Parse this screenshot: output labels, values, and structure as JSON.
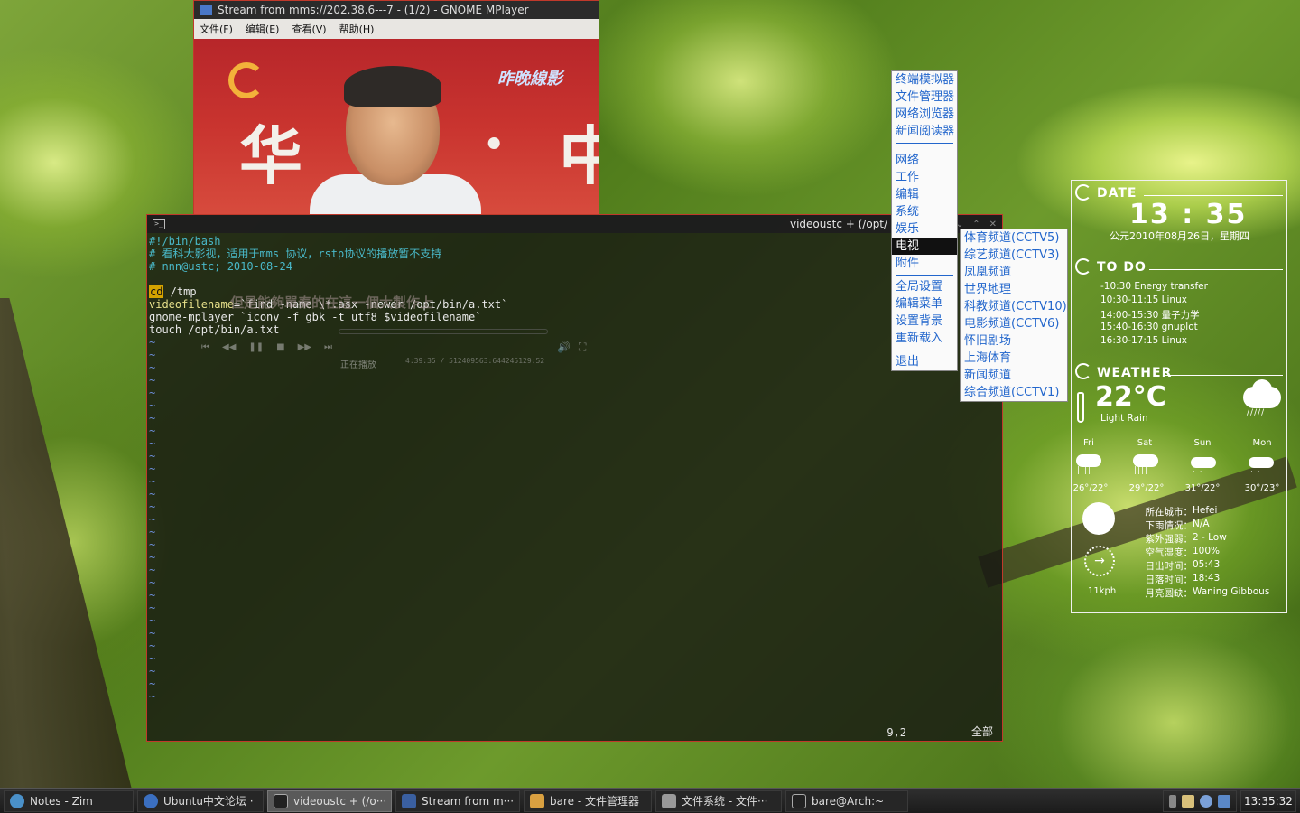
{
  "mplayer": {
    "title": "Stream from mms://202.38.6---7 - (1/2) - GNOME MPlayer",
    "menu": [
      "文件(F)",
      "编辑(E)",
      "查看(V)",
      "帮助(H)"
    ],
    "video_brand": "昨晚線影",
    "video_chars": [
      "华",
      "·",
      "中"
    ],
    "subtitle": "但是能夠單秦的在這一個大製作上",
    "status": "正在播放",
    "time": "4:39:35 / 512409563:644245129:52"
  },
  "terminal": {
    "title": "videoustc + (/opt/",
    "lines": [
      {
        "type": "comment",
        "text": "#!/bin/bash"
      },
      {
        "type": "comment",
        "text": "# 看科大影视，适用于mms 协议，rstp协议的播放暂不支持"
      },
      {
        "type": "comment",
        "text": "# nnn@ustc; 2010-08-24"
      },
      {
        "type": "blank",
        "text": ""
      },
      {
        "type": "cd",
        "tag": "cd",
        "text": " /tmp"
      },
      {
        "type": "assign",
        "var": "videofilename",
        "text": "=`find -name \\*.asx -newer /opt/bin/a.txt`"
      },
      {
        "type": "cmd",
        "text": "gnome-mplayer `iconv -f gbk -t utf8 $videofilename`"
      },
      {
        "type": "cmd",
        "text": "touch /opt/bin/a.txt"
      }
    ],
    "tilde": "~",
    "position": "9,2",
    "scroll": "全部"
  },
  "root_menu": {
    "group1": [
      "终端模拟器",
      "文件管理器",
      "网络浏览器",
      "新闻阅读器"
    ],
    "group2": [
      "网络",
      "工作",
      "编辑",
      "系统",
      "娱乐",
      "电视",
      "附件"
    ],
    "active": "电视",
    "group3": [
      "全局设置",
      "编辑菜单",
      "设置背景",
      "重新载入"
    ],
    "group4": [
      "退出"
    ]
  },
  "tv_submenu": [
    "体育频道(CCTV5)",
    "综艺频道(CCTV3)",
    "凤凰频道",
    "世界地理",
    "科教频道(CCTV10)",
    "电影频道(CCTV6)",
    "怀旧剧场",
    "上海体育",
    "新闻频道",
    "综合频道(CCTV1)"
  ],
  "conky": {
    "date_head": "DATE",
    "time": "13 : 35",
    "date": "公元2010年08月26日，星期四",
    "todo_head": "TO DO",
    "todo": [
      "-10:30 Energy transfer",
      "10:30-11:15 Linux",
      "14:00-15:30 量子力学",
      "15:40-16:30 gnuplot",
      "16:30-17:15 Linux"
    ],
    "weather_head": "WEATHER",
    "temp": "22°C",
    "condition": "Light Rain",
    "forecast": [
      {
        "day": "Fri",
        "temp": "26°/22°",
        "icon": "rain-icon"
      },
      {
        "day": "Sat",
        "temp": "29°/22°",
        "icon": "rain-icon"
      },
      {
        "day": "Sun",
        "temp": "31°/22°",
        "icon": "light-rain-icon"
      },
      {
        "day": "Mon",
        "temp": "30°/23°",
        "icon": "light-rain-icon"
      }
    ],
    "wind": "11kph",
    "info": [
      {
        "k": "所在城市：",
        "v": "Hefei"
      },
      {
        "k": "下雨情况：",
        "v": "N/A"
      },
      {
        "k": "紫外强弱：",
        "v": "2 - Low"
      },
      {
        "k": "空气湿度：",
        "v": "100%"
      },
      {
        "k": "日出时间：",
        "v": "05:43"
      },
      {
        "k": "日落时间：",
        "v": "18:43"
      },
      {
        "k": "月亮圆缺：",
        "v": "Waning Gibbous"
      }
    ]
  },
  "taskbar": {
    "tasks": [
      {
        "label": "Notes - Zim",
        "color": "#4a90c8"
      },
      {
        "label": "Ubuntu中文论坛 ·",
        "color": "#3b6fc0"
      },
      {
        "label": "videoustc + (/o···",
        "color": "#222222",
        "active": true
      },
      {
        "label": "Stream from m···",
        "color": "#3a5fa0"
      },
      {
        "label": "bare - 文件管理器",
        "color": "#d9a040"
      },
      {
        "label": "文件系统 - 文件···",
        "color": "#999999"
      },
      {
        "label": "bare@Arch:~",
        "color": "#222222"
      }
    ],
    "clock": "13:35:32"
  }
}
